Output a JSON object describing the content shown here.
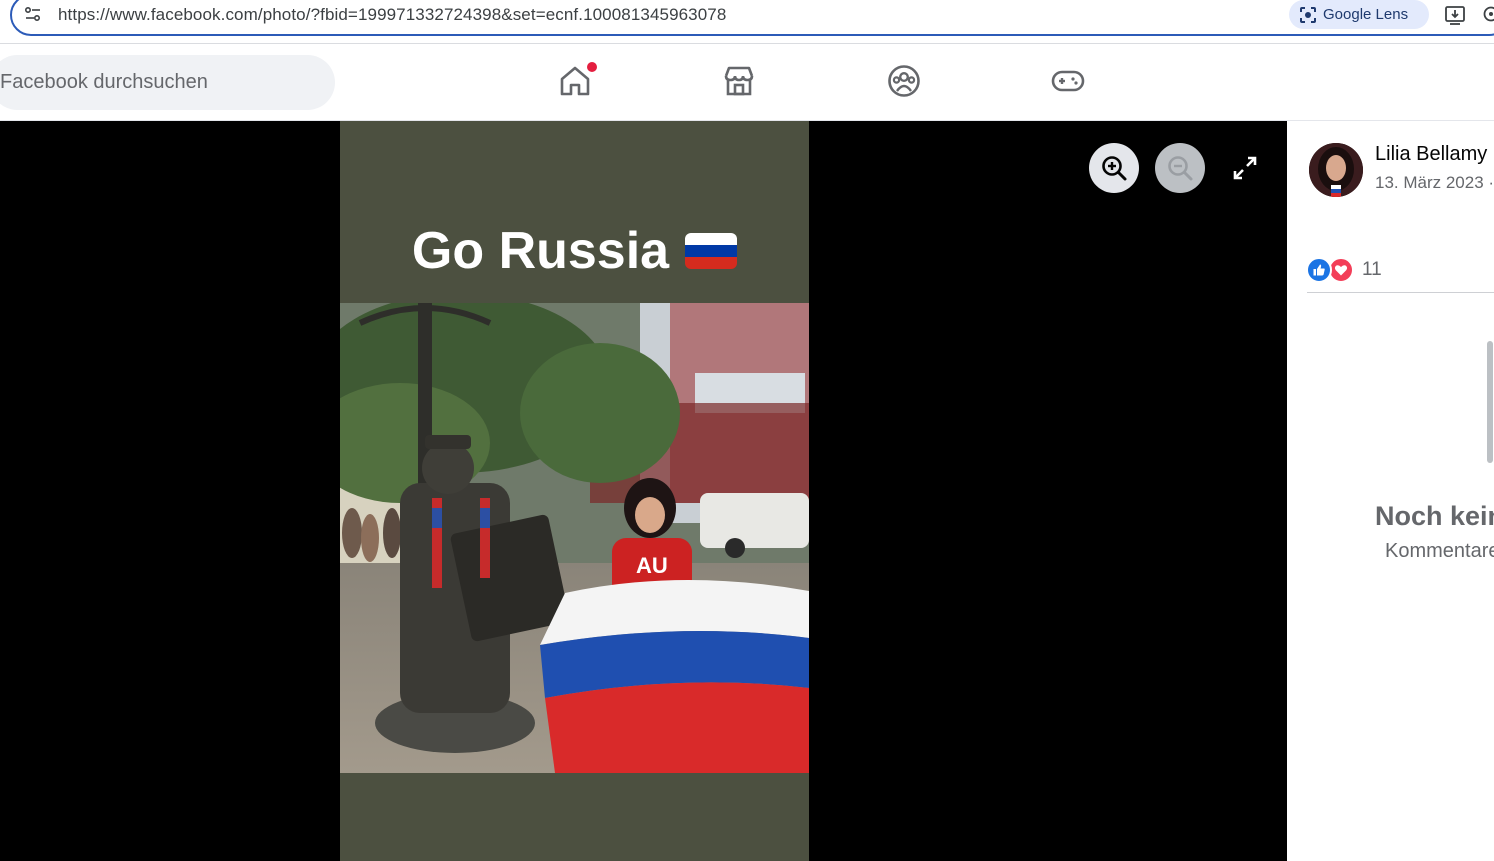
{
  "browser": {
    "url": "https://www.facebook.com/photo/?fbid=199971332724398&set=ecnf.100081345963078",
    "lens_label": "Google Lens"
  },
  "header": {
    "search_placeholder": "Facebook durchsuchen",
    "nav_icons": [
      "home-icon",
      "marketplace-icon",
      "groups-icon",
      "gaming-icon"
    ]
  },
  "photo": {
    "caption": "Go Russia",
    "flag_colors": [
      "#ffffff",
      "#0039a6",
      "#d52b1e"
    ]
  },
  "post": {
    "author": "Lilia Bellamy",
    "date": "13. März 2023 ·",
    "reaction_count": "11",
    "no_comments_title": "Noch keine",
    "no_comments_subtitle": "Kommentare"
  },
  "colors": {
    "accent": "#1b74e4",
    "love": "#f33e58",
    "notification": "#e41e3f",
    "address_border": "#2c5bb8"
  }
}
